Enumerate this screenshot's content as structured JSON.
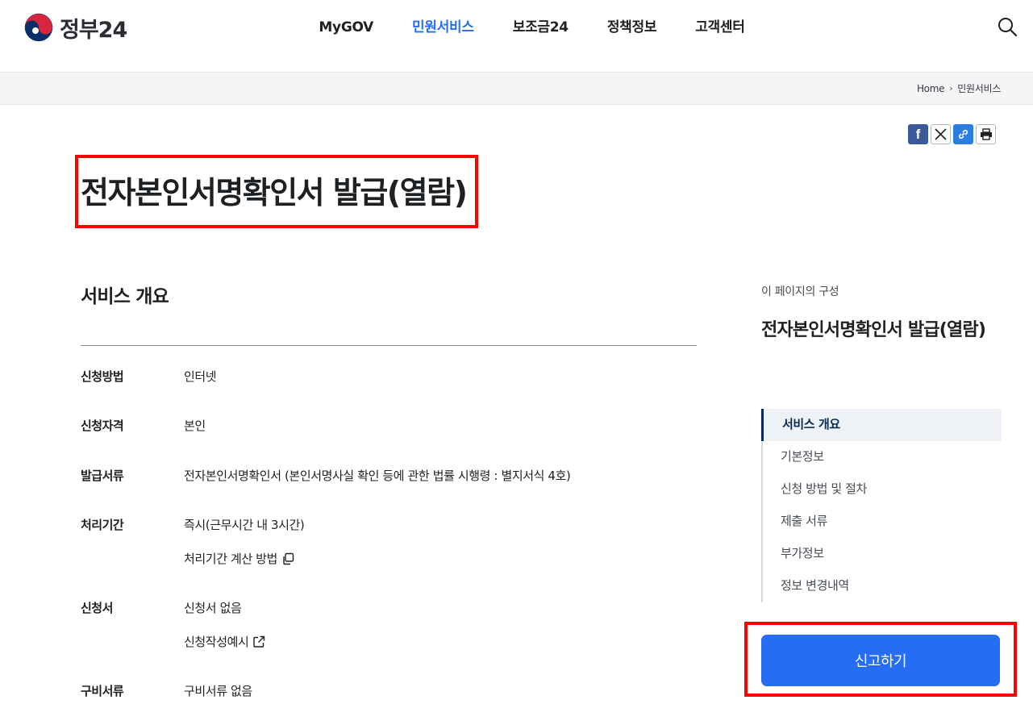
{
  "brand": {
    "logo_text": "정부24"
  },
  "nav": {
    "items": [
      {
        "label": "MyGOV",
        "active": false
      },
      {
        "label": "민원서비스",
        "active": true
      },
      {
        "label": "보조금24",
        "active": false
      },
      {
        "label": "정책정보",
        "active": false
      },
      {
        "label": "고객센터",
        "active": false
      }
    ],
    "search_icon": "search-icon"
  },
  "breadcrumb": {
    "home": "Home",
    "current": "민원서비스"
  },
  "share": {
    "icons": [
      "facebook-icon",
      "x-icon",
      "link-icon",
      "print-icon"
    ],
    "facebook_letter": "f"
  },
  "page": {
    "title": "전자본인서명확인서 발급(열람)"
  },
  "overview": {
    "title": "서비스 개요",
    "rows": [
      {
        "label": "신청방법",
        "value": "인터넷"
      },
      {
        "label": "신청자격",
        "value": "본인"
      },
      {
        "label": "발급서류",
        "value": "전자본인서명확인서 (본인서명사실 확인 등에 관한 법률 시행령 : 별지서식 4호)"
      },
      {
        "label": "처리기간",
        "value": "즉시(근무시간 내 3시간)",
        "link": "처리기간 계산 방법"
      },
      {
        "label": "신청서",
        "value": "신청서 없음",
        "link": "신청작성예시"
      },
      {
        "label": "구비서류",
        "value": "구비서류 없음"
      }
    ]
  },
  "toc": {
    "caption": "이 페이지의 구성",
    "title": "전자본인서명확인서 발급(열람)",
    "items": [
      "서비스 개요",
      "기본정보",
      "신청 방법 및 절차",
      "제출 서류",
      "부가정보",
      "정보 변경내역"
    ],
    "active_index": 0
  },
  "actions": {
    "report_label": "신고하기"
  },
  "colors": {
    "accent": "#256ef4",
    "highlight_border": "#ff0000",
    "toc_active": "#052b57"
  }
}
